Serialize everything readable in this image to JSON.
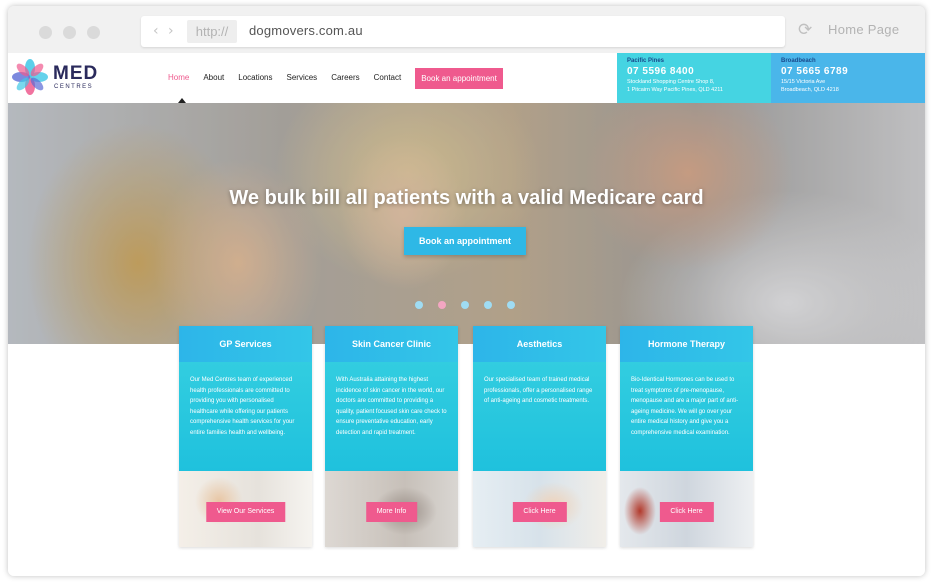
{
  "browser": {
    "back_icon": "chevron-left",
    "forward_icon": "chevron-right",
    "protocol": "http://",
    "url": "dogmovers.com.au",
    "reload_icon": "reload",
    "home_label": "Home Page"
  },
  "logo": {
    "name": "MED",
    "sub": "CENTRES"
  },
  "nav": {
    "items": [
      "Home",
      "About",
      "Locations",
      "Services",
      "Careers",
      "Contact"
    ],
    "active": "Home",
    "cta": "Book an appointment"
  },
  "locations": [
    {
      "name": "Pacific Pines",
      "phone": "07 5596 8400",
      "addr1": "Stockland Shopping Centre Shop 8,",
      "addr2": "1 Pitcairn Way Pacific Pines, QLD 4211"
    },
    {
      "name": "Broadbeach",
      "phone": "07 5665 6789",
      "addr1": "15/15 Victoria Ave",
      "addr2": "Broadbeach, QLD 4218"
    }
  ],
  "hero": {
    "title": "We bulk bill all patients with a valid Medicare card",
    "button": "Book an appointment",
    "slides": 5,
    "active_slide": 2
  },
  "services": [
    {
      "title": "GP Services",
      "text": "Our Med Centres team of experienced health professionals are committed to providing you with personalised healthcare while offering our patients comprehensive health services for your entire families health and wellbeing.",
      "button": "View Our Services"
    },
    {
      "title": "Skin Cancer Clinic",
      "text": "With Australia attaining the highest incidence of skin cancer in the world, our doctors are committed to providing a quality, patient focused skin care check to ensure preventative education, early detection and rapid treatment.",
      "button": "More Info"
    },
    {
      "title": "Aesthetics",
      "text": "Our specialised team of trained medical professionals, offer a personalised range of anti-ageing and cosmetic treatments.",
      "button": "Click Here"
    },
    {
      "title": "Hormone Therapy",
      "text": "Bio-Identical Hormones can be used to treat symptoms of pre-menopause, menopause and are a major part of anti-ageing medicine. We will go over your entire medical history and give you a comprehensive medical examination.",
      "button": "Click Here"
    }
  ],
  "colors": {
    "accent": "#ef5a8e",
    "primary": "#2eb8e6",
    "teal": "#32cde0",
    "navy": "#2a2a5c"
  }
}
